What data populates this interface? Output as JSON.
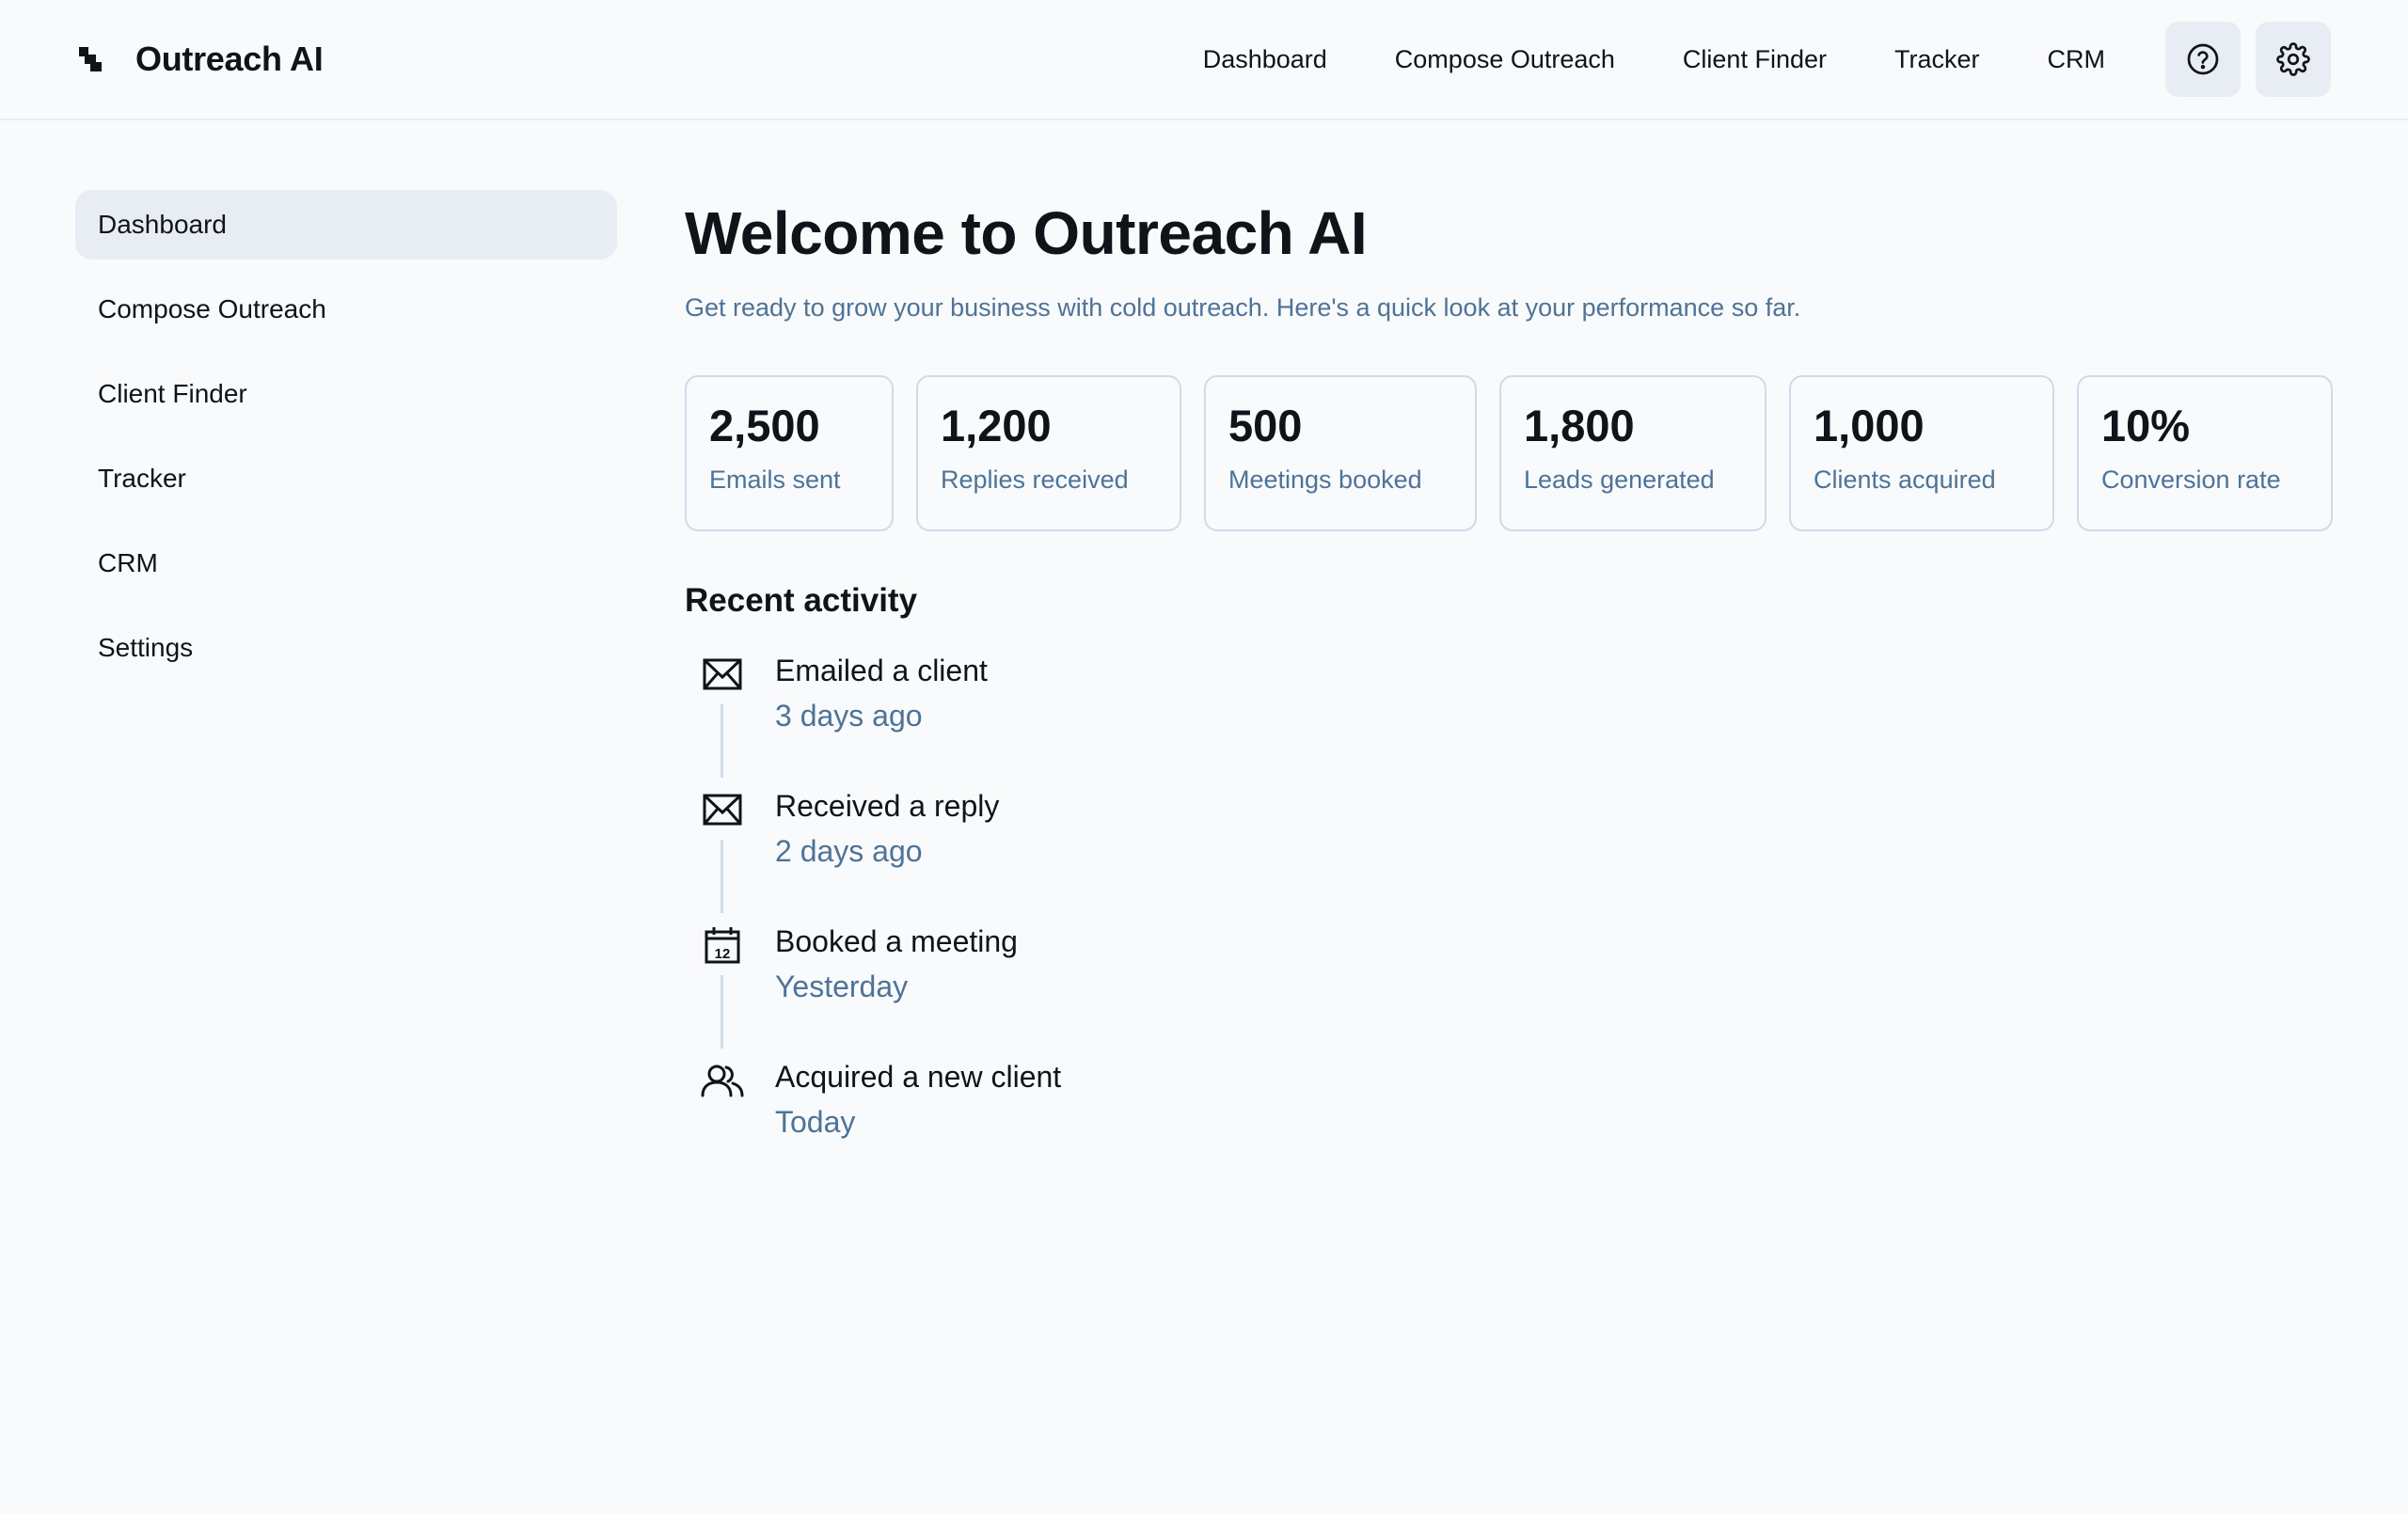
{
  "app": {
    "name": "Outreach AI"
  },
  "topnav": {
    "items": [
      {
        "label": "Dashboard"
      },
      {
        "label": "Compose Outreach"
      },
      {
        "label": "Client Finder"
      },
      {
        "label": "Tracker"
      },
      {
        "label": "CRM"
      }
    ],
    "help_icon": "help-circle-icon",
    "settings_icon": "gear-icon"
  },
  "sidebar": {
    "items": [
      {
        "label": "Dashboard",
        "active": true
      },
      {
        "label": "Compose Outreach"
      },
      {
        "label": "Client Finder"
      },
      {
        "label": "Tracker"
      },
      {
        "label": "CRM"
      },
      {
        "label": "Settings"
      }
    ]
  },
  "main": {
    "title": "Welcome to Outreach AI",
    "subtitle": "Get ready to grow your business with cold outreach. Here's a quick look at your performance so far.",
    "stats": [
      {
        "value": "2,500",
        "label": "Emails sent"
      },
      {
        "value": "1,200",
        "label": "Replies received"
      },
      {
        "value": "500",
        "label": "Meetings booked"
      },
      {
        "value": "1,800",
        "label": "Leads generated"
      },
      {
        "value": "1,000",
        "label": "Clients acquired"
      },
      {
        "value": "10%",
        "label": "Conversion rate"
      }
    ],
    "recent_title": "Recent activity",
    "activity": [
      {
        "icon": "mail-icon",
        "title": "Emailed a client",
        "time": "3 days ago"
      },
      {
        "icon": "mail-icon",
        "title": "Received a reply",
        "time": "2 days ago"
      },
      {
        "icon": "calendar-icon",
        "title": "Booked a meeting",
        "time": "Yesterday"
      },
      {
        "icon": "users-icon",
        "title": "Acquired a new client",
        "time": "Today"
      }
    ]
  },
  "colors": {
    "background": "#f8fafc",
    "text": "#0f141a",
    "muted": "#4e7397",
    "border": "#d0dbe7",
    "active_bg": "#e7edf3"
  }
}
